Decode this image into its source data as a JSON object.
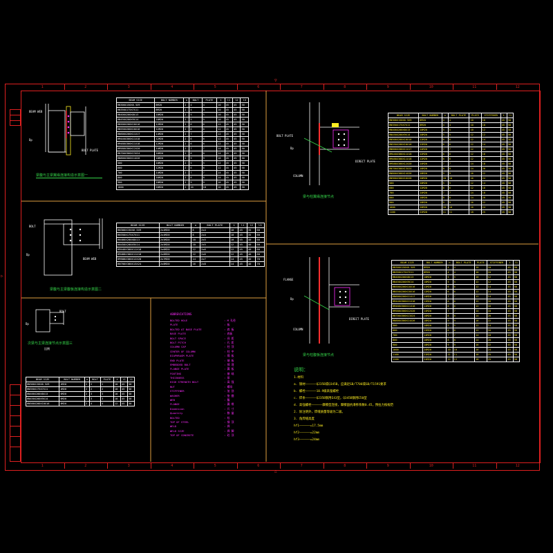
{
  "colors": {
    "border": "#e02020",
    "divider": "#e0a040",
    "caption": "#36d64a",
    "magenta": "#ff2bff",
    "yellow": "#ffee22",
    "line": "#ffffff"
  },
  "zones": [
    "1",
    "2",
    "3",
    "4",
    "5",
    "6",
    "7",
    "8",
    "9",
    "10",
    "11",
    "12"
  ],
  "zone_marks": {
    "top": "▽",
    "bottom": "△",
    "left": "▷"
  },
  "detail1": {
    "caption": "梁腹与主梁翼缘连接构造示意图一",
    "labels": {
      "a": "BEAM WEB",
      "b": "BOLT PLATE",
      "c": "Dp"
    },
    "table": {
      "headers": [
        "BEAM SIZE",
        "BOLT NUMBER",
        "n",
        "BOLT",
        "PLATE",
        "t",
        "l1",
        "l2",
        "l3"
      ],
      "rows": [
        [
          "HN300X150X6.5X9",
          "8M20",
          "2",
          "4",
          "4",
          "10",
          "45",
          "45",
          "50"
        ],
        [
          "HN350X175X7X11",
          "8M20",
          "2",
          "4",
          "4",
          "10",
          "45",
          "45",
          "50"
        ],
        [
          "HN400X200X8X13",
          "10M20",
          "2",
          "5",
          "5",
          "10",
          "45",
          "45",
          "50"
        ],
        [
          "HN450X200X9X14",
          "10M20",
          "2",
          "5",
          "5",
          "10",
          "45",
          "45",
          "50"
        ],
        [
          "HN500X200X10X16",
          "12M20",
          "2",
          "6",
          "6",
          "12",
          "45",
          "45",
          "50"
        ],
        [
          "HN550X200X10X16",
          "12M20",
          "2",
          "6",
          "6",
          "12",
          "45",
          "45",
          "50"
        ],
        [
          "HN600X200X11X17",
          "14M20",
          "2",
          "7",
          "7",
          "12",
          "45",
          "45",
          "50"
        ],
        [
          "HM440X300X11X18",
          "12M20",
          "2",
          "6",
          "6",
          "12",
          "45",
          "45",
          "50"
        ],
        [
          "HM488X300X11X18",
          "12M20",
          "2",
          "6",
          "6",
          "12",
          "45",
          "45",
          "50"
        ],
        [
          "HM588X300X12X20",
          "14M20",
          "2",
          "7",
          "7",
          "14",
          "45",
          "45",
          "50"
        ],
        [
          "HN700X300X13X24",
          "16M20",
          "2",
          "8",
          "8",
          "14",
          "45",
          "45",
          "50"
        ],
        [
          "HN800X300X14X26",
          "18M20",
          "2",
          "9",
          "9",
          "16",
          "45",
          "45",
          "50"
        ],
        [
          "500",
          "10M20",
          "2",
          "5",
          "5",
          "12",
          "45",
          "45",
          "50"
        ],
        [
          "600",
          "12M20",
          "2",
          "6",
          "6",
          "12",
          "45",
          "45",
          "50"
        ],
        [
          "700",
          "14M20",
          "2",
          "7",
          "7",
          "14",
          "45",
          "45",
          "50"
        ],
        [
          "800",
          "16M20",
          "2",
          "8",
          "8",
          "14",
          "45",
          "45",
          "50"
        ],
        [
          "900",
          "18M20",
          "2",
          "9",
          "9",
          "16",
          "45",
          "45",
          "50"
        ],
        [
          "1000",
          "20M20",
          "2",
          "10",
          "10",
          "16",
          "45",
          "45",
          "50"
        ]
      ]
    }
  },
  "detail2": {
    "caption": "梁腹与主梁腹板连接构造示意图二",
    "labels": {
      "a": "BOLT",
      "b": "Dp",
      "c": "BEAM WEB"
    },
    "table": {
      "headers": [
        "BEAM SIZE",
        "BOLT NUMBER",
        "n",
        "BOLT PLATE",
        "t",
        "l1",
        "l2",
        "l3"
      ],
      "rows": [
        [
          "HN300X150X6.5X9",
          "2x4M20",
          "8",
          "2x4",
          "10",
          "45",
          "35",
          "60"
        ],
        [
          "HN350X175X7X11",
          "2x4M20",
          "8",
          "2x4",
          "10",
          "45",
          "35",
          "60"
        ],
        [
          "HN400X200X8X13",
          "2x5M20",
          "10",
          "2x5",
          "10",
          "45",
          "40",
          "60"
        ],
        [
          "HN450X200X9X14",
          "2x5M20",
          "10",
          "2x5",
          "12",
          "45",
          "40",
          "60"
        ],
        [
          "HM440X300X11X18",
          "2x6M20",
          "12",
          "2x6",
          "12",
          "45",
          "40",
          "60"
        ],
        [
          "HM488X300X11X18",
          "2x6M20",
          "12",
          "2x6",
          "12",
          "45",
          "40",
          "60"
        ],
        [
          "HM588X300X12X20",
          "2x7M20",
          "14",
          "2x7",
          "14",
          "45",
          "40",
          "70"
        ],
        [
          "HN700X300X13X24",
          "2x8M20",
          "16",
          "2x8",
          "14",
          "45",
          "40",
          "70"
        ]
      ]
    }
  },
  "detail3": {
    "caption": "次梁与主梁连接节点示意图三",
    "subcaption": "比例",
    "labels": {
      "a": "Dp",
      "b": "BOLT"
    },
    "table": {
      "headers": [
        "BEAM SIZE",
        "BOLT NUMBER",
        "n",
        "BOLT",
        "PLATE",
        "t",
        "l1",
        "l2"
      ],
      "rows": [
        [
          "HN300X150X6.5X9",
          "4M20",
          "2",
          "2",
          "2",
          "10",
          "45",
          "50"
        ],
        [
          "HN350X175X7X11",
          "4M20",
          "2",
          "2",
          "2",
          "10",
          "45",
          "50"
        ],
        [
          "HN400X200X8X13",
          "6M20",
          "2",
          "3",
          "3",
          "10",
          "45",
          "50"
        ],
        [
          "HN450X200X9X14",
          "6M20",
          "2",
          "3",
          "3",
          "10",
          "45",
          "50"
        ],
        [
          "HN500X200X10X16",
          "8M20",
          "2",
          "4",
          "4",
          "12",
          "45",
          "50"
        ]
      ]
    }
  },
  "detail4": {
    "caption": "梁与柱翼缘连接节点",
    "labels": {
      "a": "BOLT PLATE",
      "b": "Dp",
      "c": "COLUMN",
      "d": "DIRECT PLATE"
    },
    "table": {
      "headers": [
        "BEAM SIZE",
        "BOLT NUMBER",
        "n",
        "BOLT PLATE",
        "PLATE",
        "STIFFENER",
        "t",
        "l1"
      ],
      "rows": [
        [
          "HN300X150X6.5X9",
          "8M20",
          "4",
          "4",
          "10",
          "10",
          "45",
          "50"
        ],
        [
          "HN350X175X7X11",
          "8M20",
          "4",
          "4",
          "10",
          "10",
          "45",
          "50"
        ],
        [
          "HN400X200X8X13",
          "10M20",
          "5",
          "5",
          "10",
          "12",
          "45",
          "50"
        ],
        [
          "HN450X200X9X14",
          "10M20",
          "5",
          "5",
          "12",
          "12",
          "45",
          "50"
        ],
        [
          "HN500X200X10X16",
          "12M20",
          "6",
          "6",
          "12",
          "14",
          "45",
          "50"
        ],
        [
          "HN550X200X10X16",
          "12M20",
          "6",
          "6",
          "12",
          "14",
          "45",
          "50"
        ],
        [
          "HN600X200X11X17",
          "14M20",
          "7",
          "7",
          "12",
          "14",
          "45",
          "50"
        ],
        [
          "HM440X300X11X18",
          "12M20",
          "6",
          "6",
          "12",
          "16",
          "45",
          "50"
        ],
        [
          "HM488X300X11X18",
          "12M20",
          "6",
          "6",
          "12",
          "16",
          "45",
          "50"
        ],
        [
          "HM588X300X12X20",
          "14M20",
          "7",
          "7",
          "14",
          "18",
          "45",
          "50"
        ],
        [
          "HN700X300X13X24",
          "16M20",
          "8",
          "8",
          "14",
          "20",
          "45",
          "50"
        ],
        [
          "HN800X300X14X26",
          "18M20",
          "9",
          "9",
          "16",
          "22",
          "45",
          "50"
        ],
        [
          "HN900X300X16X28",
          "20M20",
          "10",
          "10",
          "16",
          "24",
          "45",
          "50"
        ],
        [
          "500",
          "10M20",
          "5",
          "5",
          "12",
          "14",
          "45",
          "50"
        ],
        [
          "600",
          "12M20",
          "6",
          "6",
          "12",
          "16",
          "45",
          "50"
        ],
        [
          "700",
          "14M20",
          "7",
          "7",
          "14",
          "18",
          "45",
          "50"
        ],
        [
          "800",
          "16M20",
          "8",
          "8",
          "14",
          "20",
          "45",
          "50"
        ],
        [
          "900",
          "18M20",
          "9",
          "9",
          "16",
          "22",
          "45",
          "50"
        ],
        [
          "1000",
          "20M20",
          "10",
          "10",
          "16",
          "24",
          "45",
          "50"
        ],
        [
          "1100",
          "22M20",
          "11",
          "11",
          "18",
          "25",
          "45",
          "50"
        ]
      ]
    }
  },
  "detail5": {
    "caption": "梁与柱腹板连接节点",
    "labels": {
      "a": "FLANGE",
      "b": "Dp",
      "c": "COLUMN",
      "d": "DIRECT PLATE"
    },
    "table": {
      "headers": [
        "BEAM SIZE",
        "BOLT NUMBER",
        "n",
        "BOLT PLATE",
        "PLATE",
        "STIFFENER",
        "t",
        "l1"
      ],
      "rows": [
        [
          "HN300X150X6.5X9",
          "8M20",
          "4",
          "4",
          "10",
          "10",
          "45",
          "50"
        ],
        [
          "HN350X175X7X11",
          "8M20",
          "4",
          "4",
          "10",
          "10",
          "45",
          "50"
        ],
        [
          "HN400X200X8X13",
          "10M20",
          "5",
          "5",
          "10",
          "12",
          "45",
          "50"
        ],
        [
          "HN450X200X9X14",
          "10M20",
          "5",
          "5",
          "12",
          "12",
          "45",
          "50"
        ],
        [
          "HN500X200X10X16",
          "12M20",
          "6",
          "6",
          "12",
          "14",
          "45",
          "50"
        ],
        [
          "HN550X200X10X16",
          "12M20",
          "6",
          "6",
          "12",
          "14",
          "45",
          "50"
        ],
        [
          "HN600X200X11X17",
          "14M20",
          "7",
          "7",
          "12",
          "14",
          "45",
          "50"
        ],
        [
          "HM440X300X11X18",
          "12M20",
          "6",
          "6",
          "12",
          "16",
          "45",
          "50"
        ],
        [
          "HM488X300X11X18",
          "12M20",
          "6",
          "6",
          "12",
          "16",
          "45",
          "50"
        ],
        [
          "HM588X300X12X20",
          "14M20",
          "7",
          "7",
          "14",
          "18",
          "45",
          "50"
        ],
        [
          "HN700X300X13X24",
          "16M20",
          "8",
          "8",
          "14",
          "20",
          "45",
          "50"
        ],
        [
          "HN800X300X14X26",
          "18M20",
          "9",
          "9",
          "16",
          "22",
          "45",
          "50"
        ],
        [
          "500",
          "10M20",
          "5",
          "5",
          "12",
          "14",
          "45",
          "50"
        ],
        [
          "600",
          "12M20",
          "6",
          "6",
          "12",
          "16",
          "45",
          "50"
        ],
        [
          "700",
          "14M20",
          "7",
          "7",
          "14",
          "18",
          "45",
          "50"
        ],
        [
          "800",
          "16M20",
          "8",
          "8",
          "14",
          "20",
          "45",
          "50"
        ],
        [
          "900",
          "18M20",
          "9",
          "9",
          "16",
          "22",
          "45",
          "50"
        ],
        [
          "1000",
          "20M20",
          "10",
          "10",
          "16",
          "24",
          "45",
          "50"
        ],
        [
          "1100",
          "22M20",
          "11",
          "11",
          "18",
          "25",
          "45",
          "50"
        ],
        [
          "1200",
          "24M20",
          "12",
          "12",
          "18",
          "25",
          "45",
          "50"
        ]
      ]
    }
  },
  "legend": {
    "title": "ABBREVIATIONS",
    "items": [
      [
        "BOLTED HOLE",
        "M 孔径"
      ],
      [
        "PLATE",
        "板"
      ],
      [
        "BOLTED AT BASE PLATE",
        "底 板"
      ],
      [
        "BASE PLATE",
        "底板"
      ],
      [
        "BOLT SPACE",
        "间 距"
      ],
      [
        "BOLT PITCH",
        "孔 距"
      ],
      [
        "COLUMN CAP",
        "柱 顶"
      ],
      [
        "CENTER OF COLUMN",
        "柱 中"
      ],
      [
        "DIAPHRAGM PLATE",
        "隔 板"
      ],
      [
        "END PLATE",
        "端 板"
      ],
      [
        "EMBEDDED BOLT",
        "预 埋"
      ],
      [
        "FLANGE PLATE",
        "翼 板"
      ],
      [
        "FOOTING",
        "基 础"
      ],
      [
        "THICKNESS",
        "厚"
      ],
      [
        "HIGH STRENGTH BOLT",
        "高 强"
      ],
      [
        "NUT",
        "螺母"
      ],
      [
        "STIFFENER",
        "加 劲"
      ],
      [
        "WASHER",
        "垫 圈"
      ],
      [
        "WEB",
        "腹"
      ],
      [
        "FLANGE",
        "翼 缘"
      ],
      [
        "Dimension",
        "尺 寸"
      ],
      [
        "Quantity",
        "数 量"
      ],
      [
        "BOLTED",
        "栓"
      ],
      [
        "TOP OF STEEL",
        "钢 顶"
      ],
      [
        "WELD",
        "焊"
      ],
      [
        "WELD SIZE",
        "焊 脚"
      ],
      [
        "TOP OF CONCRETE",
        "砼 顶"
      ]
    ]
  },
  "notes": {
    "title": "说明：",
    "lines": [
      "1.材料",
      "a. 钢材——————Q235B或Q345B，应满足GB/T700或GB/T1591要求",
      "b. 螺栓——————10.9级高强螺栓",
      "c. 焊条——————Q235B钢用E43型，Q345B钢用E50型",
      "d. 高强螺栓——————摩擦型连接，摩擦面抗滑移系数0.45，预拉力按规范",
      "2. 除注明外，焊缝质量等级为二级。",
      "3. 角焊缝高度",
      "hf1——————=17.5mm",
      "hf2——————=22mm",
      "hf3——————=24mm"
    ]
  }
}
